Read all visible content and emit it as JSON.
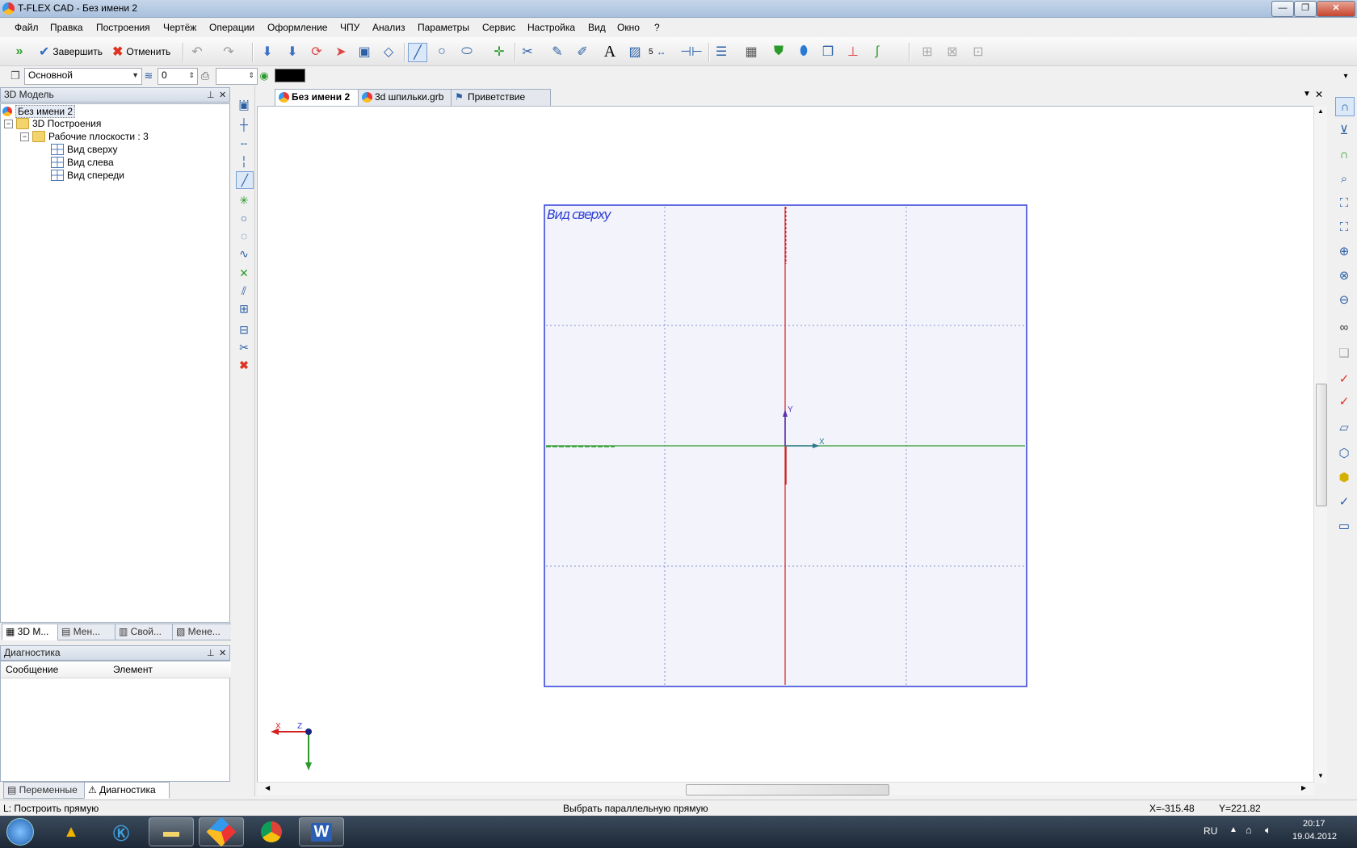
{
  "window": {
    "title": "T-FLEX CAD - Без имени 2",
    "buttons": [
      "—",
      "❐",
      "✕"
    ]
  },
  "menu": [
    "Файл",
    "Правка",
    "Построения",
    "Чертёж",
    "Операции",
    "Оформление",
    "ЧПУ",
    "Анализ",
    "Параметры",
    "Сервис",
    "Настройка",
    "Вид",
    "Окно",
    "?"
  ],
  "toolbar": {
    "finish_label": "Завершить",
    "cancel_label": "Отменить",
    "dim_number": "5"
  },
  "toolbar2": {
    "layer_value": "Основной",
    "level_value": "0",
    "accent_color": "#000000"
  },
  "model_panel": {
    "title": "3D Модель",
    "tree": {
      "root": "Без имени 2",
      "group": "3D Построения",
      "folder": "Рабочие плоскости : 3",
      "planes": [
        "Вид сверху",
        "Вид слева",
        "Вид спереди"
      ]
    },
    "tabs": [
      "3D М...",
      "Мен...",
      "Свой...",
      "Мене..."
    ]
  },
  "diag_panel": {
    "title": "Диагностика",
    "columns": [
      "Сообщение",
      "Элемент"
    ],
    "tabs": [
      "Переменные",
      "Диагностика"
    ]
  },
  "doc_tabs": [
    "Без имени 2",
    "3d шпильки.grb",
    "Приветствие"
  ],
  "viewport": {
    "plane_label": "Вид сверху",
    "axis_x": "X",
    "axis_y": "Y",
    "triad_x": "X",
    "triad_z": "Z",
    "colors": {
      "plane_border": "#2f3fd8",
      "x_axis": "#2a9a2a",
      "y_axis": "#d42020",
      "plane_fill": "#f3f4fb"
    }
  },
  "status": {
    "left": "L: Построить прямую",
    "center": "Выбрать параллельную прямую",
    "x": "X=-315.48",
    "y": "Y=221.82"
  },
  "taskbar": {
    "lang": "RU",
    "time": "20:17",
    "date": "19.04.2012"
  }
}
